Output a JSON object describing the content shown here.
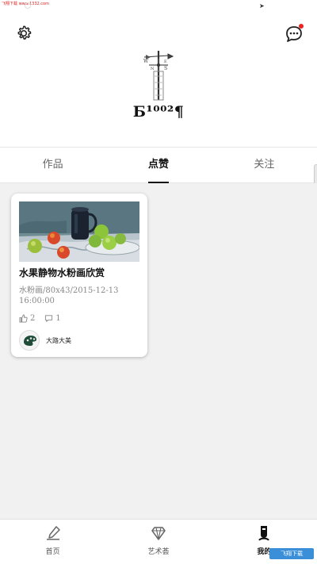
{
  "status_bar": {
    "source_text": "飞翔下载 www.1332.com"
  },
  "profile": {
    "username": "Б¹⁰⁰²¶"
  },
  "tabs": [
    {
      "label": "作品"
    },
    {
      "label": "点赞"
    },
    {
      "label": "关注"
    }
  ],
  "active_tab": 1,
  "cards": [
    {
      "title": "水果静物水粉画欣赏",
      "meta": "水粉画/80x43/2015-12-13 16:00:00",
      "likes": "2",
      "comments": "1",
      "author": "大路大美"
    }
  ],
  "bottom_nav": [
    {
      "label": "首页",
      "icon": "brush-home-icon"
    },
    {
      "label": "艺术荟",
      "icon": "diamond-icon"
    },
    {
      "label": "我的",
      "icon": "person-icon"
    }
  ],
  "watermark": {
    "text": "飞翔下载"
  },
  "colors": {
    "accent": "#111111",
    "notification": "#e22222",
    "background": "#f1f1f1"
  }
}
